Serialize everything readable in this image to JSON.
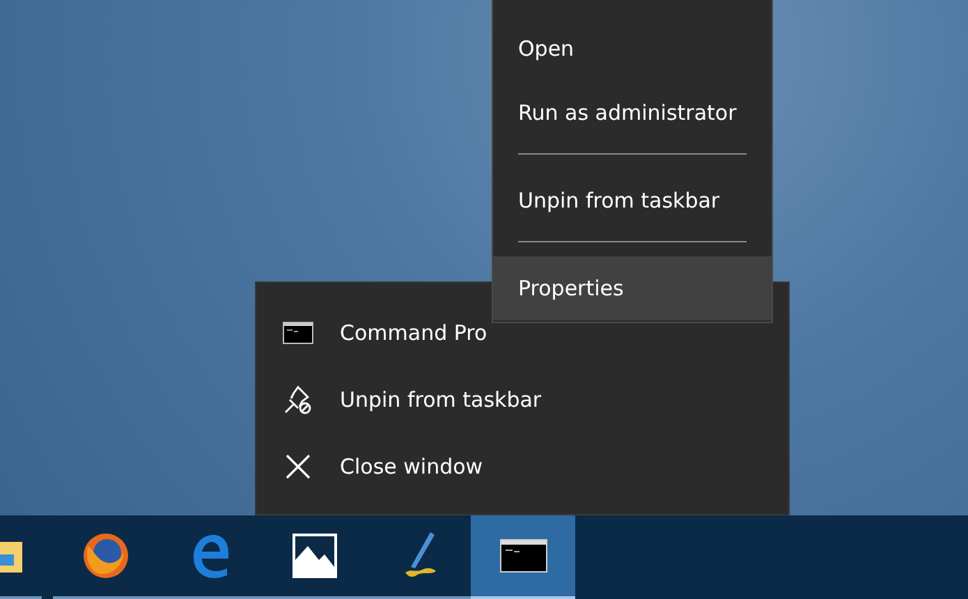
{
  "context_menu": {
    "items": [
      {
        "kind": "item",
        "label": "Open",
        "highlighted": false
      },
      {
        "kind": "item",
        "label": "Run as administrator",
        "highlighted": false
      },
      {
        "kind": "separator"
      },
      {
        "kind": "item",
        "label": "Unpin from taskbar",
        "highlighted": false
      },
      {
        "kind": "separator"
      },
      {
        "kind": "item",
        "label": "Properties",
        "highlighted": true
      }
    ]
  },
  "jump_list": {
    "items": [
      {
        "kind": "console",
        "label": "Command Pro"
      },
      {
        "kind": "unpin",
        "label": "Unpin from taskbar"
      },
      {
        "kind": "close",
        "label": "Close window"
      }
    ]
  },
  "taskbar": {
    "apps": [
      {
        "kind": "folder",
        "selected": false
      },
      {
        "kind": "browser",
        "selected": false
      },
      {
        "kind": "edge",
        "selected": false
      },
      {
        "kind": "photos",
        "selected": false
      },
      {
        "kind": "pen",
        "selected": false
      },
      {
        "kind": "console",
        "selected": true
      }
    ]
  }
}
